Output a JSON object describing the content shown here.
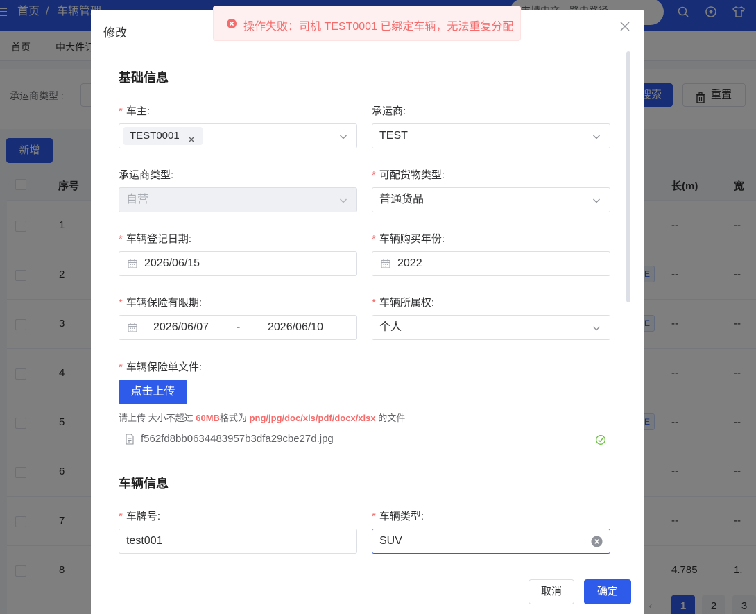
{
  "header": {
    "breadcrumb_home": "首页",
    "breadcrumb_sep": "/",
    "breadcrumb_current": "车辆管理",
    "search_text": "支持中文、路由路径"
  },
  "tabs": [
    "首页",
    "中大件订"
  ],
  "filter": {
    "carrier_type_label": "承运商类型 :",
    "search_button": "搜索",
    "reset_button": "重置"
  },
  "toolbar": {
    "add_button": "新增"
  },
  "table": {
    "columns": {
      "index": "序号",
      "length": "长(m)",
      "width": "宽"
    },
    "rows": [
      {
        "index": "1",
        "length": "--",
        "width": "--"
      },
      {
        "index": "2",
        "length": "--",
        "width": "--"
      },
      {
        "index": "3",
        "length": "--",
        "width": "--"
      },
      {
        "index": "4",
        "length": "--",
        "width": "--"
      },
      {
        "index": "5",
        "length": "--",
        "width": "--"
      },
      {
        "index": "6",
        "length": "--",
        "width": "--"
      },
      {
        "index": "7",
        "length": "--",
        "width": "--"
      },
      {
        "index": "8",
        "length": "4.785",
        "width": "1."
      }
    ]
  },
  "pagination": {
    "pages": [
      "1",
      "2",
      "3"
    ],
    "current": "1"
  },
  "toast": {
    "type": "error",
    "message": "操作失败：司机 TEST0001 已绑定车辆，无法重复分配"
  },
  "dialog": {
    "title": "修改",
    "section_basic": "基础信息",
    "section_vehicle": "车辆信息",
    "fields": {
      "owner": {
        "label": "车主:",
        "required": true,
        "tag": "TEST0001"
      },
      "carrier": {
        "label": "承运商:",
        "required": false,
        "value": "TEST"
      },
      "carrier_type": {
        "label": "承运商类型:",
        "required": false,
        "value": "自营",
        "disabled": true
      },
      "cargo_type": {
        "label": "可配货物类型:",
        "required": true,
        "value": "普通货品"
      },
      "register_date": {
        "label": "车辆登记日期:",
        "required": true,
        "value": "2026/06/15"
      },
      "purchase_year": {
        "label": "车辆购买年份:",
        "required": true,
        "value": "2022"
      },
      "insurance_period": {
        "label": "车辆保险有限期:",
        "required": true,
        "start": "2026/06/07",
        "separator": "-",
        "end": "2026/06/10"
      },
      "ownership": {
        "label": "车辆所属权:",
        "required": true,
        "value": "个人"
      },
      "insurance_file": {
        "label": "车辆保险单文件:",
        "required": true,
        "upload_button": "点击上传",
        "tip_prefix": "请上传 大小不超过",
        "tip_size": "60MB",
        "tip_mid": "格式为",
        "tip_formats": "png/jpg/doc/xls/pdf/docx/xlsx",
        "tip_suffix": "的文件",
        "file_name": "f562fd8bb0634483957b3dfa29cbe27d.jpg"
      },
      "plate": {
        "label": "车牌号:",
        "required": true,
        "value": "test001"
      },
      "vehicle_type": {
        "label": "车辆类型:",
        "required": true,
        "value": "SUV"
      }
    },
    "cancel_button": "取消",
    "confirm_button": "确定"
  },
  "colors": {
    "primary": "#2f5bea",
    "danger": "#f56c6c",
    "success": "#67c23a",
    "toast_bg": "#fef0f0"
  }
}
